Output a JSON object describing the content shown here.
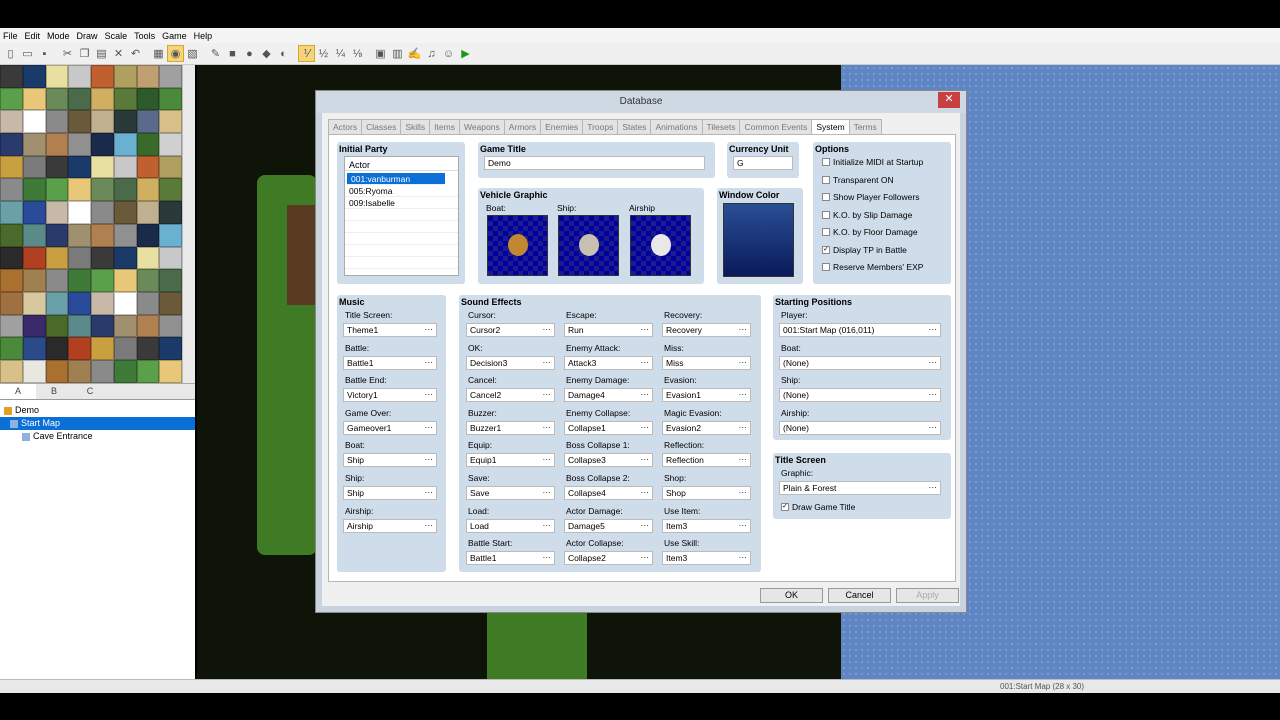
{
  "menu": [
    "File",
    "Edit",
    "Mode",
    "Draw",
    "Scale",
    "Tools",
    "Game",
    "Help"
  ],
  "toolbar_icons": [
    "new-icon",
    "open-icon",
    "save-icon",
    "cut-icon",
    "copy-icon",
    "paste-icon",
    "delete-icon",
    "undo-icon",
    "map-layer-icon",
    "event-layer-icon",
    "region-icon",
    "pencil-icon",
    "rectangle-icon",
    "ellipse-icon",
    "fill-icon",
    "shadow-pen-icon",
    "scale-1-1-icon",
    "scale-1-2-icon",
    "scale-1-4-icon",
    "scale-1-8-icon",
    "database-icon",
    "resource-manager-icon",
    "script-editor-icon",
    "sound-test-icon",
    "character-generator-icon",
    "playtest-icon"
  ],
  "palette_tabs": [
    "A",
    "B",
    "C"
  ],
  "tree": {
    "root": "Demo",
    "items": [
      "Start Map",
      "Cave Entrance"
    ]
  },
  "status_text": "001:Start Map (28 x 30)",
  "dialog": {
    "title": "Database",
    "close": "✕",
    "tabs": [
      "Actors",
      "Classes",
      "Skills",
      "Items",
      "Weapons",
      "Armors",
      "Enemies",
      "Troops",
      "States",
      "Animations",
      "Tilesets",
      "Common Events",
      "System",
      "Terms"
    ],
    "selected_tab": "System",
    "initial_party": {
      "title": "Initial Party",
      "header": "Actor",
      "members": [
        "001:vanburman",
        "005:Ryoma",
        "009:Isabelle"
      ]
    },
    "game_title": {
      "title": "Game Title",
      "value": "Demo"
    },
    "currency": {
      "title": "Currency Unit",
      "value": "G"
    },
    "vehicle": {
      "title": "Vehicle Graphic",
      "boat": "Boat:",
      "ship": "Ship:",
      "airship": "Airship"
    },
    "window_color": {
      "title": "Window Color"
    },
    "options": {
      "title": "Options",
      "items": [
        {
          "label": "Initialize MIDI at Startup",
          "checked": false
        },
        {
          "label": "Transparent ON",
          "checked": false
        },
        {
          "label": "Show Player Followers",
          "checked": false
        },
        {
          "label": "K.O. by Slip Damage",
          "checked": false
        },
        {
          "label": "K.O. by Floor Damage",
          "checked": false
        },
        {
          "label": "Display TP in Battle",
          "checked": true
        },
        {
          "label": "Reserve Members' EXP",
          "checked": false
        }
      ]
    },
    "music": {
      "title": "Music",
      "items": [
        {
          "label": "Title Screen:",
          "value": "Theme1"
        },
        {
          "label": "Battle:",
          "value": "Battle1"
        },
        {
          "label": "Battle End:",
          "value": "Victory1"
        },
        {
          "label": "Game Over:",
          "value": "Gameover1"
        },
        {
          "label": "Boat:",
          "value": "Ship"
        },
        {
          "label": "Ship:",
          "value": "Ship"
        },
        {
          "label": "Airship:",
          "value": "Airship"
        }
      ]
    },
    "sound": {
      "title": "Sound Effects",
      "col1": [
        {
          "label": "Cursor:",
          "value": "Cursor2"
        },
        {
          "label": "OK:",
          "value": "Decision3"
        },
        {
          "label": "Cancel:",
          "value": "Cancel2"
        },
        {
          "label": "Buzzer:",
          "value": "Buzzer1"
        },
        {
          "label": "Equip:",
          "value": "Equip1"
        },
        {
          "label": "Save:",
          "value": "Save"
        },
        {
          "label": "Load:",
          "value": "Load"
        },
        {
          "label": "Battle Start:",
          "value": "Battle1"
        }
      ],
      "col2": [
        {
          "label": "Escape:",
          "value": "Run"
        },
        {
          "label": "Enemy Attack:",
          "value": "Attack3"
        },
        {
          "label": "Enemy Damage:",
          "value": "Damage4"
        },
        {
          "label": "Enemy Collapse:",
          "value": "Collapse1"
        },
        {
          "label": "Boss Collapse 1:",
          "value": "Collapse3"
        },
        {
          "label": "Boss Collapse 2:",
          "value": "Collapse4"
        },
        {
          "label": "Actor Damage:",
          "value": "Damage5"
        },
        {
          "label": "Actor Collapse:",
          "value": "Collapse2"
        }
      ],
      "col3": [
        {
          "label": "Recovery:",
          "value": "Recovery"
        },
        {
          "label": "Miss:",
          "value": "Miss"
        },
        {
          "label": "Evasion:",
          "value": "Evasion1"
        },
        {
          "label": "Magic Evasion:",
          "value": "Evasion2"
        },
        {
          "label": "Reflection:",
          "value": "Reflection"
        },
        {
          "label": "Shop:",
          "value": "Shop"
        },
        {
          "label": "Use Item:",
          "value": "Item3"
        },
        {
          "label": "Use Skill:",
          "value": "Item3"
        }
      ]
    },
    "starting": {
      "title": "Starting Positions",
      "items": [
        {
          "label": "Player:",
          "value": "001:Start Map (016,011)"
        },
        {
          "label": "Boat:",
          "value": "(None)"
        },
        {
          "label": "Ship:",
          "value": "(None)"
        },
        {
          "label": "Airship:",
          "value": "(None)"
        }
      ]
    },
    "title_screen": {
      "title": "Title Screen",
      "graphic_label": "Graphic:",
      "graphic": "Plain & Forest",
      "draw_title": "Draw Game Title",
      "draw_checked": true
    },
    "buttons": {
      "ok": "OK",
      "cancel": "Cancel",
      "apply": "Apply"
    },
    "ellipsis": "···"
  }
}
